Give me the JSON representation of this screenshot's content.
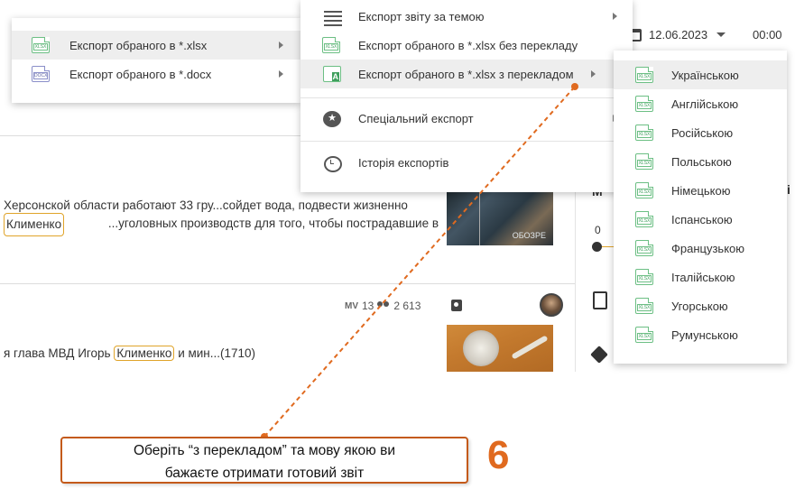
{
  "date": {
    "value": "12.06.2023",
    "time": "00:00"
  },
  "articles": [
    {
      "line1": "Херсонской области работают 33 гру...сойдет вода, подвести жизненно",
      "line2_highlight": "Клименко",
      "line2_rest": "...уголовных производств для того, чтобы пострадавшие в",
      "thumb_tag": "ОБОЗРЕ"
    },
    {
      "mv_label": "MV",
      "mv_count": "13",
      "reach": "2 613",
      "line_prefix": "я глава МВД Игорь ",
      "line_highlight": "Клименко",
      "line_rest": " и мин...(1710)"
    }
  ],
  "strip": {
    "slider_zero": "0",
    "frag_m": "M",
    "frag_i": "і"
  },
  "menu_left": {
    "items": [
      {
        "label": "Експорт обраного в *.xlsx",
        "icon": "xlsx-file-icon",
        "icon_text": "XLSX"
      },
      {
        "label": "Експорт обраного в *.docx",
        "icon": "docx-file-icon",
        "icon_text": "DOCX"
      }
    ]
  },
  "menu_mid": {
    "items": [
      {
        "label": "Експорт звіту за темою",
        "icon": "list-icon"
      },
      {
        "label": "Експорт обраного в *.xlsx без перекладу",
        "icon": "xlsx-file-icon",
        "icon_text": "XLSX"
      },
      {
        "label": "Експорт обраного в *.xlsx з перекладом",
        "icon": "translate-icon"
      },
      {
        "label": "Спеціальний експорт",
        "icon": "star-icon"
      },
      {
        "label": "Історія експортів",
        "icon": "history-icon"
      }
    ]
  },
  "menu_right": {
    "icon_text": "XLSX",
    "items": [
      "Українською",
      "Англійською",
      "Російською",
      "Польською",
      "Німецькою",
      "Іспанською",
      "Французькою",
      "Італійською",
      "Угорською",
      "Румунською"
    ]
  },
  "callout": {
    "line1": "Оберіть “з перекладом” та мову якою ви",
    "line2": "бажаєте отримати  готовий звіт",
    "step": "6"
  },
  "colors": {
    "accent": "#e06a1f",
    "highlight": "#e0a42a",
    "xlsx_green": "#3f9f5d"
  }
}
